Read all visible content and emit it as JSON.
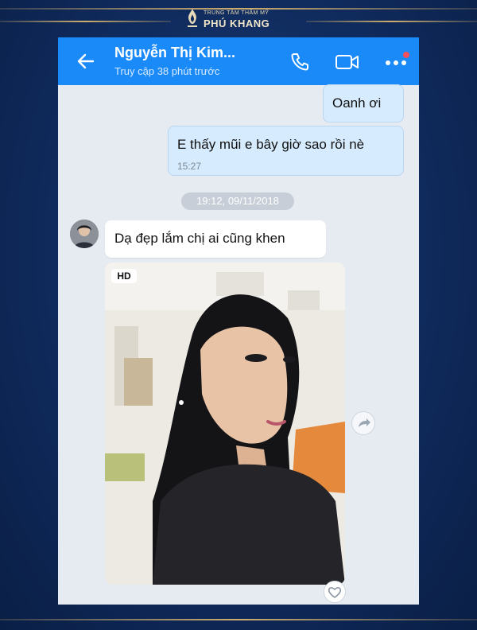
{
  "brand": {
    "tagline": "TRUNG TÂM THẨM MỸ",
    "name": "PHÚ KHANG"
  },
  "header": {
    "title": "Nguyễn Thị Kim...",
    "subtitle": "Truy cập 38 phút trước"
  },
  "messages": [
    {
      "side": "right",
      "text": "Oanh ơi"
    },
    {
      "side": "right",
      "text": "E thấy mũi e bây giờ sao rồi nè",
      "time": "15:27"
    }
  ],
  "date_separator": "19:12, 09/11/2018",
  "reply": {
    "side": "left",
    "text": "Dạ đẹp lắm chị ai cũng khen"
  },
  "photo": {
    "badge": "HD"
  },
  "colors": {
    "header_blue": "#1a8af8",
    "sent_bubble": "#d6ebfd",
    "chat_background": "#e6ebf1",
    "notification_dot": "#f4505b",
    "frame_navy": "#0f2a5c",
    "frame_gold": "#cfae6e"
  },
  "icons": [
    "back-arrow-icon",
    "phone-icon",
    "video-call-icon",
    "more-icon",
    "share-icon",
    "heart-icon"
  ]
}
